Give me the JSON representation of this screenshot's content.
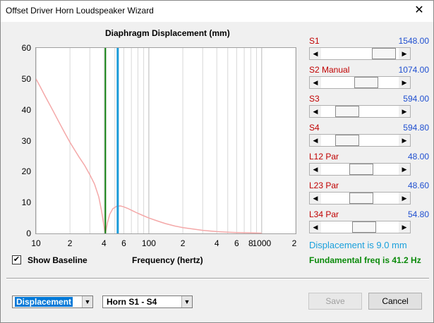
{
  "window": {
    "title": "Offset Driver Horn Loudspeaker Wizard",
    "close_glyph": "✕"
  },
  "chart_data": {
    "type": "line",
    "title": "Diaphragm Displacement (mm)",
    "xlabel": "Frequency (hertz)",
    "ylabel": "",
    "x_scale": "log",
    "xlim": [
      10,
      2000
    ],
    "ylim": [
      0,
      60
    ],
    "yticks": [
      0,
      10,
      20,
      30,
      40,
      50,
      60
    ],
    "xtick_labels": [
      {
        "x": 10,
        "label": "10"
      },
      {
        "x": 20,
        "label": "2"
      },
      {
        "x": 40,
        "label": "4"
      },
      {
        "x": 60,
        "label": "6"
      },
      {
        "x": 100,
        "label": "100"
      },
      {
        "x": 200,
        "label": "2"
      },
      {
        "x": 400,
        "label": "4"
      },
      {
        "x": 600,
        "label": "6"
      },
      {
        "x": 800,
        "label": "8"
      },
      {
        "x": 1000,
        "label": "1000"
      },
      {
        "x": 2000,
        "label": "2"
      }
    ],
    "grid": true,
    "series": [
      {
        "color": "#f4a8a8",
        "x": [
          10,
          11,
          12,
          14,
          16,
          18,
          20,
          22,
          24,
          27,
          30,
          33,
          36,
          38,
          40,
          41.2,
          43,
          45,
          48,
          52,
          56,
          60,
          65,
          70,
          80,
          90,
          100,
          120,
          140,
          170,
          200,
          250,
          300,
          400,
          500,
          600,
          800,
          1000
        ],
        "y": [
          50,
          47.2,
          44.5,
          40,
          36,
          32.5,
          29.5,
          27,
          24.8,
          22,
          19,
          16,
          11.8,
          7.5,
          2.5,
          0,
          3.5,
          6.2,
          8,
          8.8,
          8.9,
          8.6,
          8.1,
          7.5,
          6.5,
          5.7,
          5,
          4,
          3.2,
          2.4,
          1.9,
          1.4,
          1.0,
          0.6,
          0.4,
          0.3,
          0.2,
          0.1
        ]
      }
    ],
    "markers": [
      {
        "x": 41.2,
        "color": "#0a7a0a"
      },
      {
        "x": 53,
        "color": "#1a9ad8"
      }
    ]
  },
  "checkbox": {
    "label": "Show Baseline",
    "checked": true,
    "mark": "✔"
  },
  "sliders": [
    {
      "name": "S1",
      "value": "1548.00",
      "level": 0.95
    },
    {
      "name": "S2  Manual",
      "value": "1074.00",
      "level": 0.62
    },
    {
      "name": "S3",
      "value": "594.00",
      "level": 0.26
    },
    {
      "name": "S4",
      "value": "594.80",
      "level": 0.26
    },
    {
      "name": "L12  Par",
      "value": "48.00",
      "level": 0.52
    },
    {
      "name": "L23  Par",
      "value": "48.60",
      "level": 0.52
    },
    {
      "name": "L34  Par",
      "value": "54.80",
      "level": 0.58
    }
  ],
  "status": {
    "displacement": "Displacement is 9.0 mm",
    "fundamental": "Fundamental freq is 41.2 Hz"
  },
  "combos": {
    "plot_type": "Displacement",
    "horn": "Horn S1 - S4",
    "arrow": "▼"
  },
  "buttons": {
    "save": "Save",
    "cancel": "Cancel"
  },
  "arrows": {
    "left": "◀",
    "right": "▶"
  }
}
